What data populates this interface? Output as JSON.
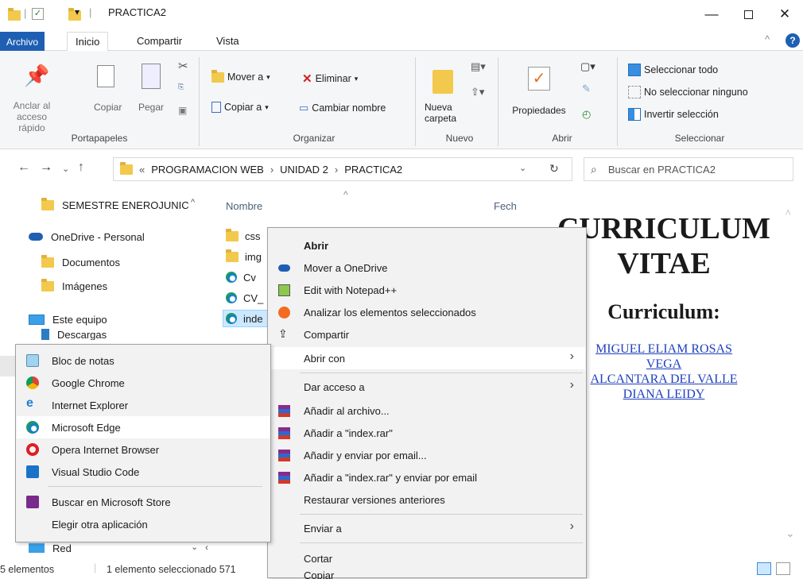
{
  "window": {
    "title": "PRACTICA2"
  },
  "ribbon_tabs": [
    "Archivo",
    "Inicio",
    "Compartir",
    "Vista"
  ],
  "ribbon": {
    "portapapeles": {
      "anclar": "Anclar al acceso rápido",
      "copiar": "Copiar",
      "pegar": "Pegar",
      "label": "Portapapeles"
    },
    "organizar": {
      "mover": "Mover a",
      "copiar_a": "Copiar a",
      "eliminar": "Eliminar",
      "cambiar": "Cambiar nombre",
      "label": "Organizar"
    },
    "nuevo": {
      "nueva_carpeta": "Nueva carpeta",
      "label": "Nuevo"
    },
    "abrir": {
      "propiedades": "Propiedades",
      "label": "Abrir"
    },
    "seleccionar": {
      "todo": "Seleccionar todo",
      "ninguno": "No seleccionar ninguno",
      "invertir": "Invertir selección",
      "label": "Seleccionar"
    }
  },
  "address": {
    "overflow": "«",
    "crumbs": [
      "PROGRAMACION WEB",
      "UNIDAD 2",
      "PRACTICA2"
    ],
    "search_placeholder": "Buscar en PRACTICA2"
  },
  "nav_pane": {
    "items": [
      "SEMESTRE ENEROJUNIC",
      "OneDrive - Personal",
      "Documentos",
      "Imágenes",
      "Este equipo",
      "Descargas",
      "Red"
    ]
  },
  "columns": {
    "nombre": "Nombre",
    "fecha": "Fech"
  },
  "files": [
    {
      "name": "css",
      "type": "folder"
    },
    {
      "name": "img",
      "type": "folder"
    },
    {
      "name": "Cv",
      "type": "edge"
    },
    {
      "name": "CV_",
      "type": "edge"
    },
    {
      "name": "inde",
      "type": "edge"
    }
  ],
  "preview": {
    "title_line1": "CURRICULUM",
    "title_line2": "VITAE",
    "subtitle": "Curriculum:",
    "links": [
      "MIGUEL ELIAM ROSAS",
      "VEGA",
      "ALCANTARA DEL VALLE",
      "DIANA LEIDY"
    ]
  },
  "context_menu": {
    "abrir": "Abrir",
    "onedrive": "Mover a OneDrive",
    "notepad": "Edit with Notepad++",
    "avast": "Analizar los elementos seleccionados",
    "compartir": "Compartir",
    "abrir_con": "Abrir con",
    "dar_acceso": "Dar acceso a",
    "rar1": "Añadir al archivo...",
    "rar2": "Añadir a \"index.rar\"",
    "rar3": "Añadir y enviar por email...",
    "rar4": "Añadir a \"index.rar\" y enviar por email",
    "restaurar": "Restaurar versiones anteriores",
    "enviar": "Enviar a",
    "cortar": "Cortar",
    "copiar": "Copiar"
  },
  "submenu": {
    "items": [
      "Bloc de notas",
      "Google Chrome",
      "Internet Explorer",
      "Microsoft Edge",
      "Opera Internet Browser",
      "Visual Studio Code"
    ],
    "store": "Buscar en Microsoft Store",
    "other": "Elegir otra aplicación"
  },
  "status": {
    "count": "5 elementos",
    "selected": "1 elemento seleccionado 571"
  }
}
